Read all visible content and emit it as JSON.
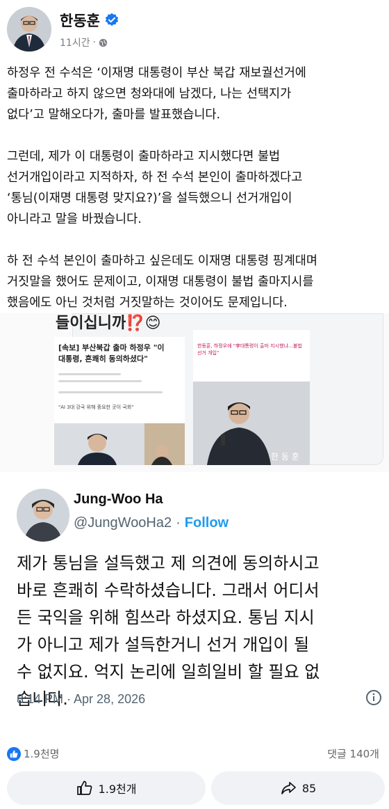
{
  "post": {
    "author": "한동훈",
    "time": "11시간",
    "separator": "·",
    "paragraphs": [
      [
        "하정우 전 수석은 ‘이재명 대통령이 부산 북갑 재보궐선거에",
        "출마하라고 하지 않으면 청와대에 남겠다, 나는 선택지가",
        "없다’고 말해오다가, 출마를 발표했습니다."
      ],
      [
        "그런데, 제가 이 대통령이 출마하라고 지시했다면 불법",
        "선거개입이라고 지적하자, 하 전 수석 본인이 출마하겠다고",
        "‘통님(이재명 대통령 맞지요?)’을 설득했으니 선거개입이",
        "아니라고 말을 바꿨습니다."
      ],
      [
        "하 전 수석 본인이 출마하고 싶은데도 이재명 대통령 핑계대며",
        "거짓말을 했어도 문제이고, 이재명 대통령이 불법 출마지시를",
        "했음에도 아닌 것처럼 거짓말하는 것이어도 문제입니다."
      ]
    ]
  },
  "embed": {
    "top_text": "들이십니까⁉️😊",
    "news_headline_red": "[속보] 부산북갑 출마 하정우 \"이",
    "news_headline_rest": "대통령, 흔쾌히 동의하셨다\"",
    "news_sub": "\"AI 3대 강국 위해 중요한 곳이 국회\"",
    "news_right_title": "한동훈, 하정우에 \"李대통령이 출마 지시했냐…불법 선거 개입\"",
    "photo_caption": "한 동 훈"
  },
  "tweet": {
    "name": "Jung-Woo Ha",
    "handle": "@JungWooHa2",
    "dot": "·",
    "follow": "Follow",
    "lines": [
      "제가 통님을 설득했고 제 의견에 동의하시고",
      "바로 흔쾌히 수락하셨습니다. 그래서 어디서",
      "든 국익을 위해 힘쓰라 하셨지요. 통님 지시",
      "가 아니고 제가 설득한거니 선거 개입이 될",
      "수 없지요. 억지 논리에 일희일비 할 필요 없",
      "습니다."
    ],
    "timestamp": "8:14 PM · Apr 28, 2026"
  },
  "reactions": {
    "count": "1.9천명",
    "comments": "댓글 140개"
  },
  "actions": {
    "like_label": "1.9천개",
    "share_label": "85"
  },
  "colors": {
    "facebook_blue": "#1877f2",
    "twitter_blue": "#1d9bf0",
    "headline_accent": "#c2185b"
  }
}
